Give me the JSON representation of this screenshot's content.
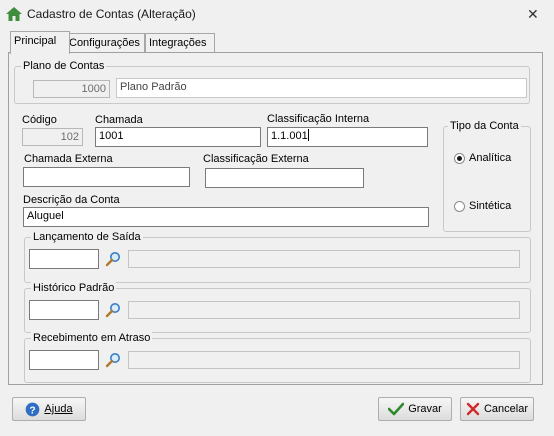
{
  "window": {
    "title": "Cadastro de Contas (Alteração)",
    "close_glyph": "✕"
  },
  "tabs": [
    {
      "label": "Principal",
      "active": true
    },
    {
      "label": "Configurações",
      "active": false
    },
    {
      "label": "Integrações",
      "active": false
    }
  ],
  "plano": {
    "legend": "Plano de Contas",
    "code": "1000",
    "name": "Plano Padrão"
  },
  "codigo": {
    "label": "Código",
    "value": "102"
  },
  "chamada": {
    "label": "Chamada",
    "value": "1001"
  },
  "classificacao_interna": {
    "label": "Classificação Interna",
    "value": "1.1.001"
  },
  "tipo_conta": {
    "legend": "Tipo da Conta",
    "options": [
      {
        "label": "Analítica",
        "selected": true
      },
      {
        "label": "Sintética",
        "selected": false
      }
    ]
  },
  "chamada_externa": {
    "label": "Chamada Externa",
    "value": ""
  },
  "classificacao_externa": {
    "label": "Classificação Externa",
    "value": ""
  },
  "descricao": {
    "label": "Descrição da Conta",
    "value": "Aluguel"
  },
  "lancamento_saida": {
    "legend": "Lançamento de Saída",
    "code": "",
    "description": ""
  },
  "historico_padrao": {
    "legend": "Histórico Padrão",
    "code": "",
    "description": ""
  },
  "recebimento_atraso": {
    "legend": "Recebimento em Atraso",
    "code": "",
    "description": ""
  },
  "buttons": {
    "help": "Ajuda",
    "save": "Gravar",
    "cancel": "Cancelar"
  },
  "colors": {
    "window_bg": "#f0f0f0",
    "help_icon": "#2f6fc3",
    "save_check": "#2b8a2b",
    "cancel_x": "#d12a2a",
    "home_icon": "#3e8e3e"
  },
  "icons": {
    "title": "home-icon",
    "lookup": "search-icon",
    "help": "help-icon",
    "save": "checkmark-icon",
    "cancel": "cross-icon"
  }
}
